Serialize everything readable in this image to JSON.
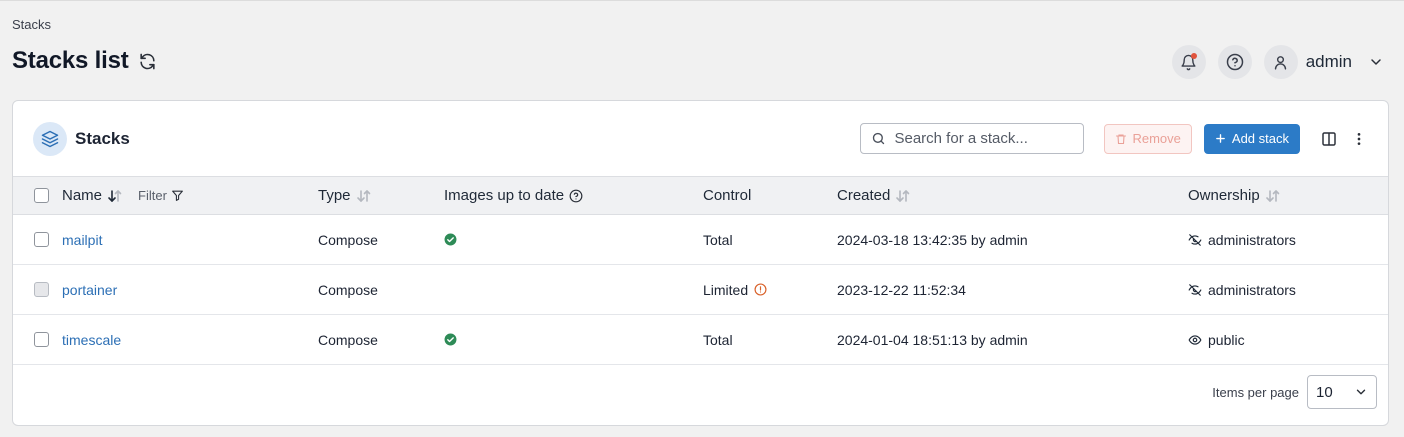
{
  "breadcrumb": "Stacks",
  "page": {
    "title": "Stacks list"
  },
  "header": {
    "user_name": "admin"
  },
  "card": {
    "title": "Stacks",
    "search_placeholder": "Search for a stack...",
    "remove_label": "Remove",
    "add_label": "Add stack"
  },
  "table": {
    "columns": {
      "name": "Name",
      "filter": "Filter",
      "type": "Type",
      "images": "Images up to date",
      "control": "Control",
      "created": "Created",
      "ownership": "Ownership"
    },
    "rows": [
      {
        "name": "mailpit",
        "type": "Compose",
        "images_up_to_date": true,
        "control": "Total",
        "control_warning": false,
        "created": "2024-03-18 13:42:35 by admin",
        "ownership": "administrators",
        "ownership_icon": "eye-off-icon",
        "selectable": true
      },
      {
        "name": "portainer",
        "type": "Compose",
        "images_up_to_date": false,
        "control": "Limited",
        "control_warning": true,
        "created": "2023-12-22 11:52:34",
        "ownership": "administrators",
        "ownership_icon": "eye-off-icon",
        "selectable": false
      },
      {
        "name": "timescale",
        "type": "Compose",
        "images_up_to_date": true,
        "control": "Total",
        "control_warning": false,
        "created": "2024-01-04 18:51:13 by admin",
        "ownership": "public",
        "ownership_icon": "eye-icon",
        "selectable": true
      }
    ]
  },
  "footer": {
    "items_per_page_label": "Items per page",
    "items_per_page": "10"
  },
  "colors": {
    "accent": "#2c7bc7",
    "link": "#2c6fb5",
    "success": "#2e8b57",
    "warning": "#d9622b",
    "remove": "#eaa198"
  }
}
